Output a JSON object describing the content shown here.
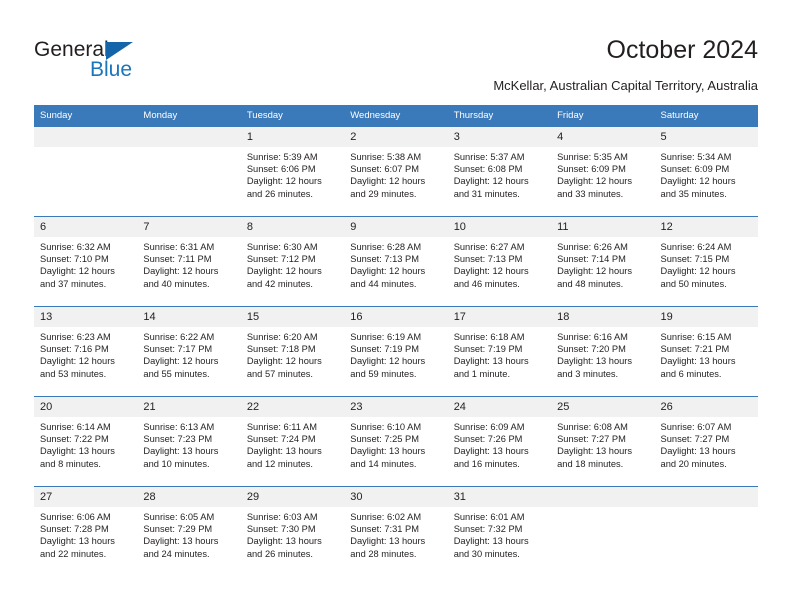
{
  "brand": {
    "name_part1": "General",
    "name_part2": "Blue",
    "triangle_color": "#1464aa",
    "blue_color": "#1b75bb"
  },
  "header": {
    "title": "October 2024",
    "subtitle": "McKellar, Australian Capital Territory, Australia"
  },
  "theme": {
    "header_bg": "#3a79ba",
    "daynum_bg": "#f1f1f1",
    "text": "#231f20",
    "page_bg": "#ffffff"
  },
  "weekday_headers": [
    "Sunday",
    "Monday",
    "Tuesday",
    "Wednesday",
    "Thursday",
    "Friday",
    "Saturday"
  ],
  "weeks": [
    [
      {
        "day": "",
        "sunrise": "",
        "sunset": "",
        "daylight1": "",
        "daylight2": ""
      },
      {
        "day": "",
        "sunrise": "",
        "sunset": "",
        "daylight1": "",
        "daylight2": ""
      },
      {
        "day": "1",
        "sunrise": "Sunrise: 5:39 AM",
        "sunset": "Sunset: 6:06 PM",
        "daylight1": "Daylight: 12 hours",
        "daylight2": "and 26 minutes."
      },
      {
        "day": "2",
        "sunrise": "Sunrise: 5:38 AM",
        "sunset": "Sunset: 6:07 PM",
        "daylight1": "Daylight: 12 hours",
        "daylight2": "and 29 minutes."
      },
      {
        "day": "3",
        "sunrise": "Sunrise: 5:37 AM",
        "sunset": "Sunset: 6:08 PM",
        "daylight1": "Daylight: 12 hours",
        "daylight2": "and 31 minutes."
      },
      {
        "day": "4",
        "sunrise": "Sunrise: 5:35 AM",
        "sunset": "Sunset: 6:09 PM",
        "daylight1": "Daylight: 12 hours",
        "daylight2": "and 33 minutes."
      },
      {
        "day": "5",
        "sunrise": "Sunrise: 5:34 AM",
        "sunset": "Sunset: 6:09 PM",
        "daylight1": "Daylight: 12 hours",
        "daylight2": "and 35 minutes."
      }
    ],
    [
      {
        "day": "6",
        "sunrise": "Sunrise: 6:32 AM",
        "sunset": "Sunset: 7:10 PM",
        "daylight1": "Daylight: 12 hours",
        "daylight2": "and 37 minutes."
      },
      {
        "day": "7",
        "sunrise": "Sunrise: 6:31 AM",
        "sunset": "Sunset: 7:11 PM",
        "daylight1": "Daylight: 12 hours",
        "daylight2": "and 40 minutes."
      },
      {
        "day": "8",
        "sunrise": "Sunrise: 6:30 AM",
        "sunset": "Sunset: 7:12 PM",
        "daylight1": "Daylight: 12 hours",
        "daylight2": "and 42 minutes."
      },
      {
        "day": "9",
        "sunrise": "Sunrise: 6:28 AM",
        "sunset": "Sunset: 7:13 PM",
        "daylight1": "Daylight: 12 hours",
        "daylight2": "and 44 minutes."
      },
      {
        "day": "10",
        "sunrise": "Sunrise: 6:27 AM",
        "sunset": "Sunset: 7:13 PM",
        "daylight1": "Daylight: 12 hours",
        "daylight2": "and 46 minutes."
      },
      {
        "day": "11",
        "sunrise": "Sunrise: 6:26 AM",
        "sunset": "Sunset: 7:14 PM",
        "daylight1": "Daylight: 12 hours",
        "daylight2": "and 48 minutes."
      },
      {
        "day": "12",
        "sunrise": "Sunrise: 6:24 AM",
        "sunset": "Sunset: 7:15 PM",
        "daylight1": "Daylight: 12 hours",
        "daylight2": "and 50 minutes."
      }
    ],
    [
      {
        "day": "13",
        "sunrise": "Sunrise: 6:23 AM",
        "sunset": "Sunset: 7:16 PM",
        "daylight1": "Daylight: 12 hours",
        "daylight2": "and 53 minutes."
      },
      {
        "day": "14",
        "sunrise": "Sunrise: 6:22 AM",
        "sunset": "Sunset: 7:17 PM",
        "daylight1": "Daylight: 12 hours",
        "daylight2": "and 55 minutes."
      },
      {
        "day": "15",
        "sunrise": "Sunrise: 6:20 AM",
        "sunset": "Sunset: 7:18 PM",
        "daylight1": "Daylight: 12 hours",
        "daylight2": "and 57 minutes."
      },
      {
        "day": "16",
        "sunrise": "Sunrise: 6:19 AM",
        "sunset": "Sunset: 7:19 PM",
        "daylight1": "Daylight: 12 hours",
        "daylight2": "and 59 minutes."
      },
      {
        "day": "17",
        "sunrise": "Sunrise: 6:18 AM",
        "sunset": "Sunset: 7:19 PM",
        "daylight1": "Daylight: 13 hours",
        "daylight2": "and 1 minute."
      },
      {
        "day": "18",
        "sunrise": "Sunrise: 6:16 AM",
        "sunset": "Sunset: 7:20 PM",
        "daylight1": "Daylight: 13 hours",
        "daylight2": "and 3 minutes."
      },
      {
        "day": "19",
        "sunrise": "Sunrise: 6:15 AM",
        "sunset": "Sunset: 7:21 PM",
        "daylight1": "Daylight: 13 hours",
        "daylight2": "and 6 minutes."
      }
    ],
    [
      {
        "day": "20",
        "sunrise": "Sunrise: 6:14 AM",
        "sunset": "Sunset: 7:22 PM",
        "daylight1": "Daylight: 13 hours",
        "daylight2": "and 8 minutes."
      },
      {
        "day": "21",
        "sunrise": "Sunrise: 6:13 AM",
        "sunset": "Sunset: 7:23 PM",
        "daylight1": "Daylight: 13 hours",
        "daylight2": "and 10 minutes."
      },
      {
        "day": "22",
        "sunrise": "Sunrise: 6:11 AM",
        "sunset": "Sunset: 7:24 PM",
        "daylight1": "Daylight: 13 hours",
        "daylight2": "and 12 minutes."
      },
      {
        "day": "23",
        "sunrise": "Sunrise: 6:10 AM",
        "sunset": "Sunset: 7:25 PM",
        "daylight1": "Daylight: 13 hours",
        "daylight2": "and 14 minutes."
      },
      {
        "day": "24",
        "sunrise": "Sunrise: 6:09 AM",
        "sunset": "Sunset: 7:26 PM",
        "daylight1": "Daylight: 13 hours",
        "daylight2": "and 16 minutes."
      },
      {
        "day": "25",
        "sunrise": "Sunrise: 6:08 AM",
        "sunset": "Sunset: 7:27 PM",
        "daylight1": "Daylight: 13 hours",
        "daylight2": "and 18 minutes."
      },
      {
        "day": "26",
        "sunrise": "Sunrise: 6:07 AM",
        "sunset": "Sunset: 7:27 PM",
        "daylight1": "Daylight: 13 hours",
        "daylight2": "and 20 minutes."
      }
    ],
    [
      {
        "day": "27",
        "sunrise": "Sunrise: 6:06 AM",
        "sunset": "Sunset: 7:28 PM",
        "daylight1": "Daylight: 13 hours",
        "daylight2": "and 22 minutes."
      },
      {
        "day": "28",
        "sunrise": "Sunrise: 6:05 AM",
        "sunset": "Sunset: 7:29 PM",
        "daylight1": "Daylight: 13 hours",
        "daylight2": "and 24 minutes."
      },
      {
        "day": "29",
        "sunrise": "Sunrise: 6:03 AM",
        "sunset": "Sunset: 7:30 PM",
        "daylight1": "Daylight: 13 hours",
        "daylight2": "and 26 minutes."
      },
      {
        "day": "30",
        "sunrise": "Sunrise: 6:02 AM",
        "sunset": "Sunset: 7:31 PM",
        "daylight1": "Daylight: 13 hours",
        "daylight2": "and 28 minutes."
      },
      {
        "day": "31",
        "sunrise": "Sunrise: 6:01 AM",
        "sunset": "Sunset: 7:32 PM",
        "daylight1": "Daylight: 13 hours",
        "daylight2": "and 30 minutes."
      },
      {
        "day": "",
        "sunrise": "",
        "sunset": "",
        "daylight1": "",
        "daylight2": ""
      },
      {
        "day": "",
        "sunrise": "",
        "sunset": "",
        "daylight1": "",
        "daylight2": ""
      }
    ]
  ]
}
